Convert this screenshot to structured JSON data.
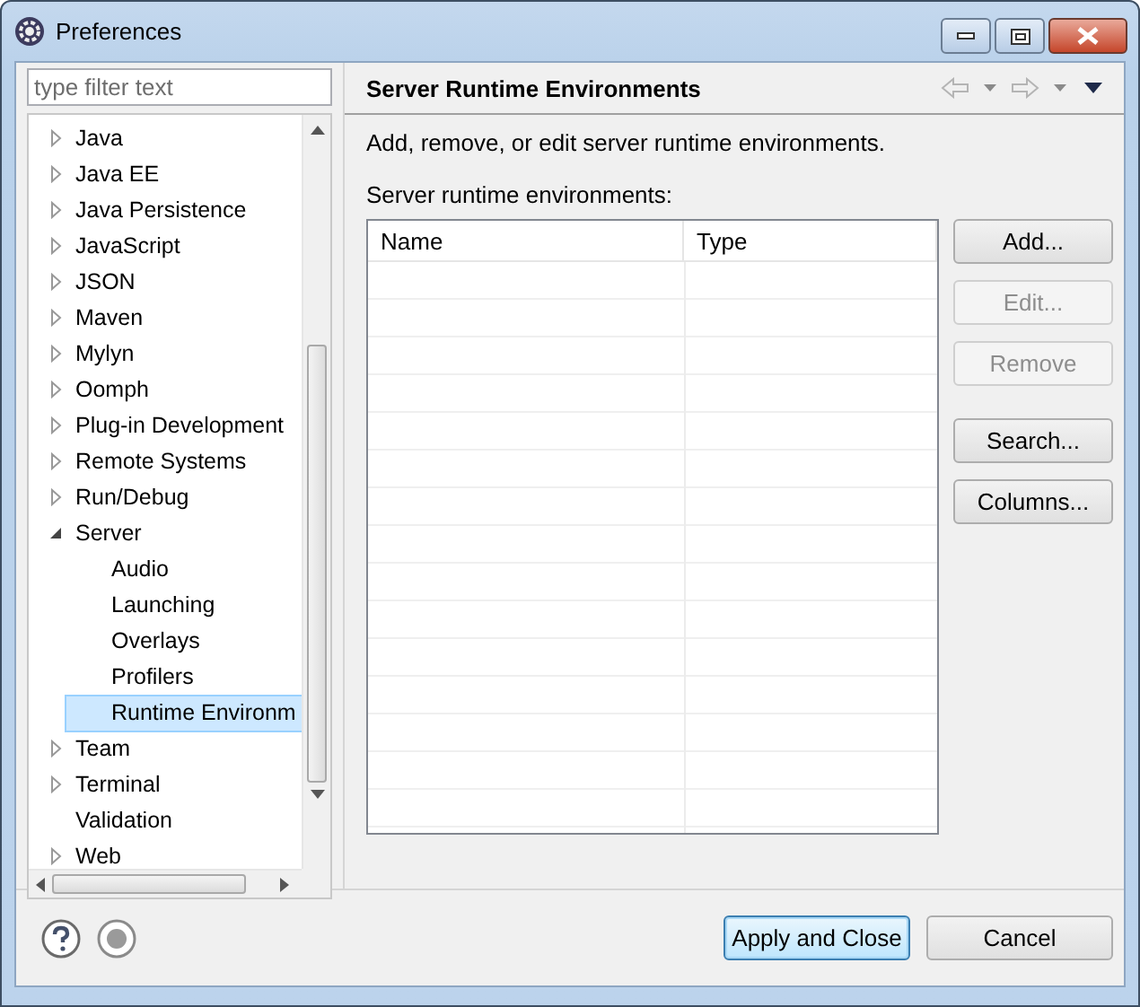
{
  "window": {
    "title": "Preferences"
  },
  "filter": {
    "placeholder": "type filter text"
  },
  "tree": [
    {
      "label": "Java",
      "expanded": false,
      "selected": false
    },
    {
      "label": "Java EE",
      "expanded": false,
      "selected": false
    },
    {
      "label": "Java Persistence",
      "expanded": false,
      "selected": false
    },
    {
      "label": "JavaScript",
      "expanded": false,
      "selected": false
    },
    {
      "label": "JSON",
      "expanded": false,
      "selected": false
    },
    {
      "label": "Maven",
      "expanded": false,
      "selected": false
    },
    {
      "label": "Mylyn",
      "expanded": false,
      "selected": false
    },
    {
      "label": "Oomph",
      "expanded": false,
      "selected": false
    },
    {
      "label": "Plug-in Development",
      "expanded": false,
      "selected": false
    },
    {
      "label": "Remote Systems",
      "expanded": false,
      "selected": false
    },
    {
      "label": "Run/Debug",
      "expanded": false,
      "selected": false
    },
    {
      "label": "Server",
      "expanded": true,
      "selected": false,
      "children": [
        {
          "label": "Audio",
          "selected": false
        },
        {
          "label": "Launching",
          "selected": false
        },
        {
          "label": "Overlays",
          "selected": false
        },
        {
          "label": "Profilers",
          "selected": false
        },
        {
          "label": "Runtime Environm",
          "selected": true
        }
      ]
    },
    {
      "label": "Team",
      "expanded": false,
      "selected": false
    },
    {
      "label": "Terminal",
      "expanded": false,
      "selected": false
    },
    {
      "label": "Validation",
      "selected": false
    },
    {
      "label": "Web",
      "expanded": false,
      "selected": false
    }
  ],
  "page": {
    "title": "Server Runtime Environments",
    "description": "Add, remove, or edit server runtime environments.",
    "table_label": "Server runtime environments:",
    "table": {
      "columns": [
        "Name",
        "Type"
      ]
    },
    "button_groups": [
      [
        {
          "label": "Add...",
          "disabled": false
        },
        {
          "label": "Edit...",
          "disabled": true
        },
        {
          "label": "Remove",
          "disabled": true
        }
      ],
      [
        {
          "label": "Search...",
          "disabled": false
        },
        {
          "label": "Columns...",
          "disabled": false
        }
      ]
    ]
  },
  "footer": {
    "buttons": [
      {
        "label": "Apply and Close",
        "default": true
      },
      {
        "label": "Cancel",
        "default": false
      }
    ]
  }
}
